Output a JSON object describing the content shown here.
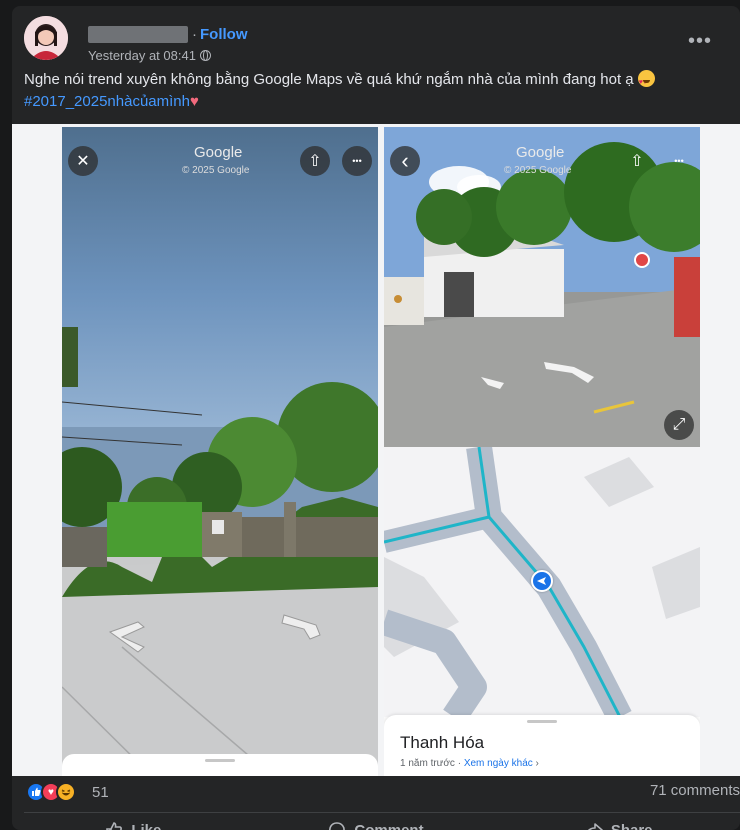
{
  "post": {
    "follow_label": "Follow",
    "separator": "·",
    "timestamp": "Yesterday at 08:41",
    "more_label": "•••",
    "text_main": "Nghe nói trend xuyên không bằng Google Maps về quá khứ ngắm nhà của mình đang hot ạ ",
    "hashtag": "#2017_2025nhàcủamình"
  },
  "streetview_left": {
    "brand": "Google",
    "copyright": "© 2025 Google",
    "close_glyph": "✕",
    "share_glyph": "⇧",
    "more_glyph": "•••"
  },
  "streetview_right": {
    "brand": "Google",
    "copyright": "© 2025 Google",
    "back_glyph": "‹",
    "share_glyph": "⇧",
    "more_glyph": "•••",
    "expand_glyph": "⤢"
  },
  "map_sheet": {
    "place_name": "Thanh Hóa",
    "subtitle_prefix": "1 năm trước · ",
    "subtitle_link": "Xem ngày khác",
    "subtitle_chevron": " ›"
  },
  "stats": {
    "reaction_count": "51",
    "comments": "71 comments"
  },
  "actions": {
    "like": "Like",
    "comment": "Comment",
    "share": "Share"
  },
  "colors": {
    "background": "#18191a",
    "card": "#242526",
    "link_blue": "#4599ff",
    "map_route": "#1fb5c8"
  }
}
